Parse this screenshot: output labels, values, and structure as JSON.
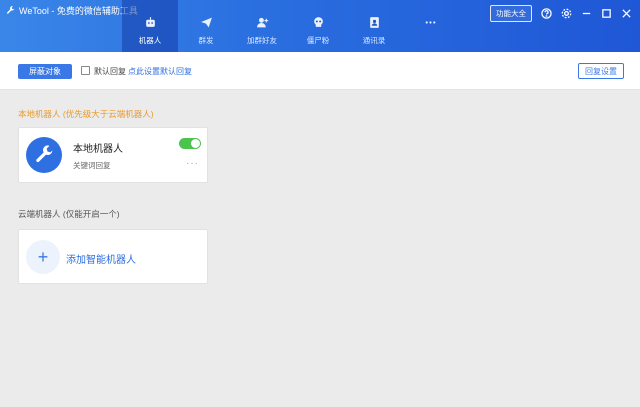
{
  "app": {
    "title": "WeTool - 免费的微信辅助工具"
  },
  "nav": {
    "tabs": [
      {
        "label": "机器人",
        "icon": "robot-icon",
        "active": true
      },
      {
        "label": "群发",
        "icon": "send-icon",
        "active": false
      },
      {
        "label": "加群好友",
        "icon": "add-friend-icon",
        "active": false
      },
      {
        "label": "僵尸粉",
        "icon": "zombie-icon",
        "active": false
      },
      {
        "label": "通讯录",
        "icon": "contacts-icon",
        "active": false
      },
      {
        "label": "",
        "icon": "more-icon",
        "active": false
      }
    ]
  },
  "window": {
    "func_label": "功能大全"
  },
  "toolbar": {
    "shield_label": "屏蔽对象",
    "default_reply_label": "默认回复",
    "default_reply_checked": false,
    "set_default_link": "点此设置默认回复",
    "reply_settings_label": "回复设置"
  },
  "local": {
    "section_title": "本地机器人 (优先级大于云端机器人)",
    "robot_name": "本地机器人",
    "robot_sub": "关键词回复",
    "enabled": true,
    "more": "···"
  },
  "cloud": {
    "section_title": "云端机器人 (仅能开启一个)",
    "add_label": "添加智能机器人",
    "plus": "+"
  },
  "colors": {
    "primary": "#3b78e7",
    "accent_orange": "#e89a2a",
    "toggle_green": "#4cc34c"
  }
}
